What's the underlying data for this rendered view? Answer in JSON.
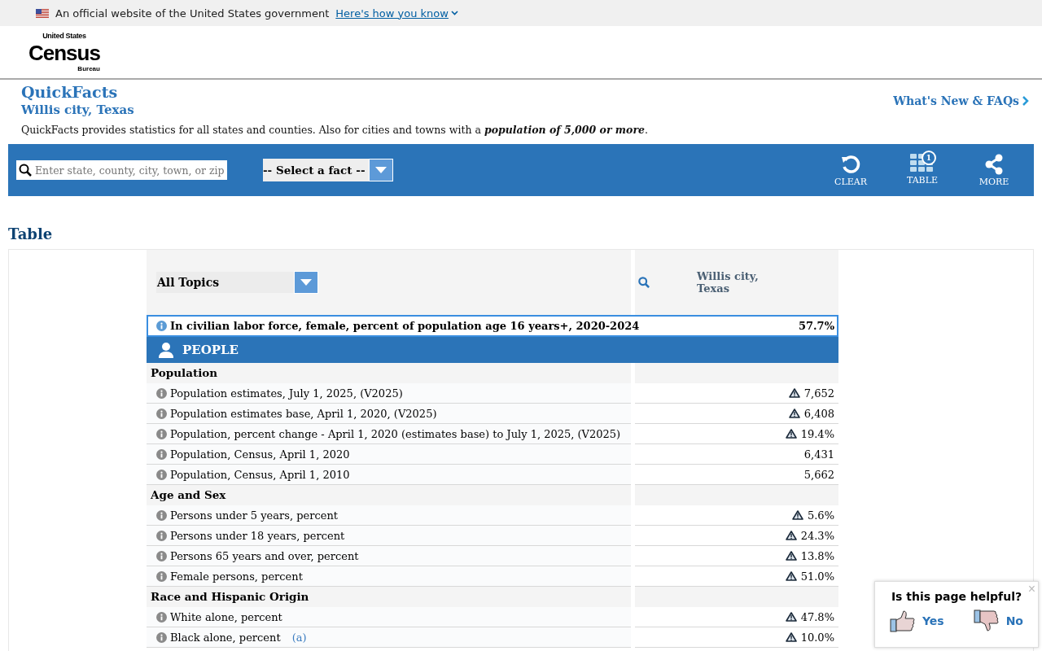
{
  "gov_banner": {
    "text": "An official website of the United States government",
    "link": "Here's how you know"
  },
  "logo": {
    "top": "United States",
    "main": "Census",
    "bottom": "Bureau"
  },
  "header": {
    "title": "QuickFacts",
    "subtitle": "Willis city, Texas",
    "whats_new": "What's New & FAQs",
    "intro": "QuickFacts provides statistics for all states and counties. Also for cities and towns with a **population of 5,000 or more**."
  },
  "toolbar": {
    "search": {
      "placeholder": "Enter state, county, city, town, or zip"
    },
    "fact_select": "-- Select a fact --",
    "actions": [
      {
        "kind": "clear",
        "label": "CLEAR"
      },
      {
        "kind": "table",
        "label": "TABLE",
        "badge": "1"
      },
      {
        "kind": "more",
        "label": "MORE"
      }
    ]
  },
  "section_title": "Table",
  "table": {
    "topic_select": "All Topics",
    "column": "Willis city, Texas",
    "highlight": {
      "label": "In civilian labor force, female, percent of population age 16 years+, 2020-2024",
      "value": "57.7%"
    },
    "category": "PEOPLE",
    "rows": [
      {
        "kind": "group",
        "label": "Population"
      },
      {
        "kind": "fact",
        "label": "Population estimates, July 1, 2025, (V2025)",
        "value": "7,652",
        "warning": true
      },
      {
        "kind": "fact",
        "label": "Population estimates base, April 1, 2020, (V2025)",
        "value": "6,408",
        "warning": true
      },
      {
        "kind": "fact",
        "label": "Population, percent change - April 1, 2020 (estimates base) to July 1, 2025, (V2025)",
        "value": "19.4%",
        "warning": true
      },
      {
        "kind": "fact",
        "label": "Population, Census, April 1, 2020",
        "value": "6,431",
        "warning": false
      },
      {
        "kind": "fact",
        "label": "Population, Census, April 1, 2010",
        "value": "5,662",
        "warning": false
      },
      {
        "kind": "group",
        "label": "Age and Sex"
      },
      {
        "kind": "fact",
        "label": "Persons under 5 years, percent",
        "value": "5.6%",
        "warning": true
      },
      {
        "kind": "fact",
        "label": "Persons under 18 years, percent",
        "value": "24.3%",
        "warning": true
      },
      {
        "kind": "fact",
        "label": "Persons 65 years and over, percent",
        "value": "13.8%",
        "warning": true
      },
      {
        "kind": "fact",
        "label": "Female persons, percent",
        "value": "51.0%",
        "warning": true
      },
      {
        "kind": "group",
        "label": "Race and Hispanic Origin"
      },
      {
        "kind": "fact",
        "label": "White alone, percent",
        "value": "47.8%",
        "warning": true
      },
      {
        "kind": "fact",
        "label": "Black alone, percent",
        "note": "(a)",
        "value": "10.0%",
        "warning": true
      }
    ]
  },
  "feedback": {
    "question": "Is this page helpful?",
    "close": "×",
    "yes": "Yes",
    "no": "No"
  }
}
